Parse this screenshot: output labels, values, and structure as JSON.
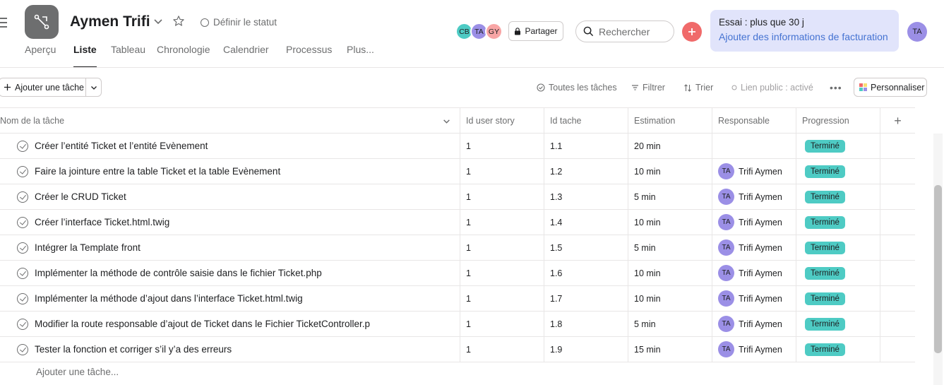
{
  "header": {
    "project_title": "Aymen Trifi",
    "status_label": "Définir le statut",
    "members": [
      {
        "initials": "CB",
        "color": "#4ecbc4"
      },
      {
        "initials": "TA",
        "color": "#9b8fe6"
      },
      {
        "initials": "GY",
        "color": "#f8a5a5"
      }
    ],
    "share_label": "Partager",
    "search_placeholder": "Rechercher",
    "trial_line1": "Essai : plus que 30 j",
    "trial_line2": "Ajouter des informations de facturation",
    "user_initials": "TA"
  },
  "tabs": [
    {
      "label": "Aperçu"
    },
    {
      "label": "Liste"
    },
    {
      "label": "Tableau"
    },
    {
      "label": "Chronologie"
    },
    {
      "label": "Calendrier"
    },
    {
      "label": "Processus"
    },
    {
      "label": "Plus..."
    }
  ],
  "toolbar": {
    "add_task_label": "Ajouter une tâche",
    "all_tasks_label": "Toutes les tâches",
    "filter_label": "Filtrer",
    "sort_label": "Trier",
    "public_link_label": "Lien public : activé",
    "more_label": "•••",
    "customize_label": "Personnaliser"
  },
  "table": {
    "columns": [
      "Nom de la tâche",
      "Id user story",
      "Id tache",
      "Estimation",
      "Responsable",
      "Progression"
    ],
    "add_column_label": "+",
    "rows": [
      {
        "name": "Créer l’entité Ticket et l’entité Evènement",
        "user_story": "1",
        "task_id": "1.1",
        "estimate": "20 min",
        "assignee": "",
        "assignee_initials": "",
        "progress": "Terminé"
      },
      {
        "name": "Faire la jointure entre la table Ticket et la table Evènement",
        "user_story": "1",
        "task_id": "1.2",
        "estimate": "10 min",
        "assignee": "Trifi Aymen",
        "assignee_initials": "TA",
        "progress": "Terminé"
      },
      {
        "name": "Créer le CRUD Ticket",
        "user_story": "1",
        "task_id": "1.3",
        "estimate": "5 min",
        "assignee": "Trifi Aymen",
        "assignee_initials": "TA",
        "progress": "Terminé"
      },
      {
        "name": "Créer l’interface Ticket.html.twig",
        "user_story": "1",
        "task_id": "1.4",
        "estimate": "10 min",
        "assignee": "Trifi Aymen",
        "assignee_initials": "TA",
        "progress": "Terminé"
      },
      {
        "name": "Intégrer la Template front",
        "user_story": "1",
        "task_id": "1.5",
        "estimate": "5 min",
        "assignee": "Trifi Aymen",
        "assignee_initials": "TA",
        "progress": "Terminé"
      },
      {
        "name": "Implémenter la méthode de contrôle saisie dans le fichier Ticket.php",
        "user_story": "1",
        "task_id": "1.6",
        "estimate": "10 min",
        "assignee": "Trifi Aymen",
        "assignee_initials": "TA",
        "progress": "Terminé"
      },
      {
        "name": "Implémenter la méthode d’ajout dans l’interface Ticket.html.twig",
        "user_story": "1",
        "task_id": "1.7",
        "estimate": "10 min",
        "assignee": "Trifi Aymen",
        "assignee_initials": "TA",
        "progress": "Terminé"
      },
      {
        "name": "Modifier la route responsable d’ajout de Ticket dans le Fichier TicketController.p",
        "user_story": "1",
        "task_id": "1.8",
        "estimate": "5 min",
        "assignee": "Trifi Aymen",
        "assignee_initials": "TA",
        "progress": "Terminé"
      },
      {
        "name": "Tester la fonction et corriger s’il y’a des erreurs",
        "user_story": "1",
        "task_id": "1.9",
        "estimate": "15 min",
        "assignee": "Trifi Aymen",
        "assignee_initials": "TA",
        "progress": "Terminé"
      }
    ],
    "add_row_label": "Ajouter une tâche..."
  },
  "colors": {
    "accent_red": "#f06a6a",
    "badge_done": "#4ecbc4",
    "avatar_purple": "#9b8fe6",
    "trial_bg": "#e1e4fb",
    "link_blue": "#4573d2"
  }
}
